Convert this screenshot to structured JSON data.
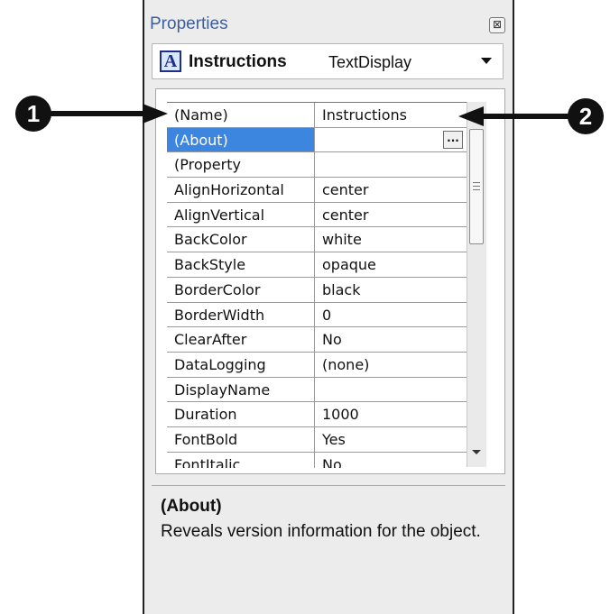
{
  "panel": {
    "title": "Properties",
    "close_label": "⊠"
  },
  "object_selector": {
    "icon_letter": "A",
    "name": "Instructions",
    "type": "TextDisplay"
  },
  "property_grid": {
    "selected_row": 1,
    "ellipsis_label": "...",
    "rows": [
      {
        "name": "(Name)",
        "value": "Instructions"
      },
      {
        "name": "(About)",
        "value": ""
      },
      {
        "name": "(Property",
        "value": ""
      },
      {
        "name": "AlignHorizontal",
        "value": "center"
      },
      {
        "name": "AlignVertical",
        "value": "center"
      },
      {
        "name": "BackColor",
        "value": "white"
      },
      {
        "name": "BackStyle",
        "value": "opaque"
      },
      {
        "name": "BorderColor",
        "value": "black"
      },
      {
        "name": "BorderWidth",
        "value": "0"
      },
      {
        "name": "ClearAfter",
        "value": "No"
      },
      {
        "name": "DataLogging",
        "value": "(none)"
      },
      {
        "name": "DisplayName",
        "value": ""
      },
      {
        "name": "Duration",
        "value": "1000"
      },
      {
        "name": "FontBold",
        "value": "Yes"
      },
      {
        "name": "FontItalic",
        "value": "No"
      }
    ]
  },
  "description": {
    "title": "(About)",
    "text": "Reveals version information for the object."
  },
  "callouts": [
    {
      "label": "1"
    },
    {
      "label": "2"
    }
  ]
}
